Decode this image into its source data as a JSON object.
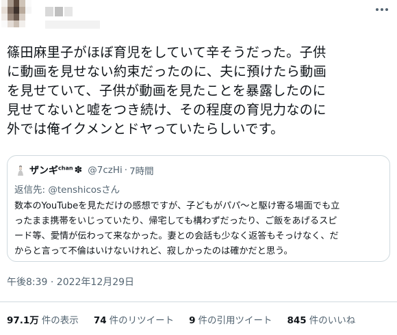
{
  "tweet": {
    "text": "篠田麻里子がほぼ育児をしていて辛そうだった。子供\nに動画を見せない約束だったのに、夫に預けたら動画\nを見せていて、子供が動画を見たことを暴露したのに\n見せてないと嘘をつき続け、その程度の育児力なのに\n外では俺イクメンとドヤっていたらしいです。"
  },
  "quote": {
    "name": "ザンギ",
    "name_sup": "chan",
    "name_emoji": "✽",
    "handle": "@7czHi",
    "dot": "·",
    "time": "7時間",
    "reply_prefix": "返信先: ",
    "reply_mention": "@tenshicos",
    "reply_suffix": "さん",
    "body": "数本のYouTubeを見ただけの感想ですが、子どもがパパ〜と駆け寄る場面でも立\nったまま携帯をいじっていたり、帰宅しても構わずだったり、ご飯をあげるスピ\nード等、愛情が伝わって来なかった。妻との会話も少なく返答もそっけなく、だ\nからと言って不倫はいけないけれど、寂しかったのは確かだと思う。"
  },
  "timestamp": "午後8:39 · 2022年12月29日",
  "stats": [
    {
      "value": "97.1万",
      "label": "件の表示"
    },
    {
      "value": "74",
      "label": "件のリツイート"
    },
    {
      "value": "9",
      "label": "件の引用ツイート"
    },
    {
      "value": "845",
      "label": "件のいいね"
    }
  ],
  "colors": {
    "text": "#0f1419",
    "secondary": "#536471",
    "border": "#cfd9de"
  },
  "icons": {
    "more": "more-dots-icon",
    "quote_avatar": "avatar-icon"
  }
}
